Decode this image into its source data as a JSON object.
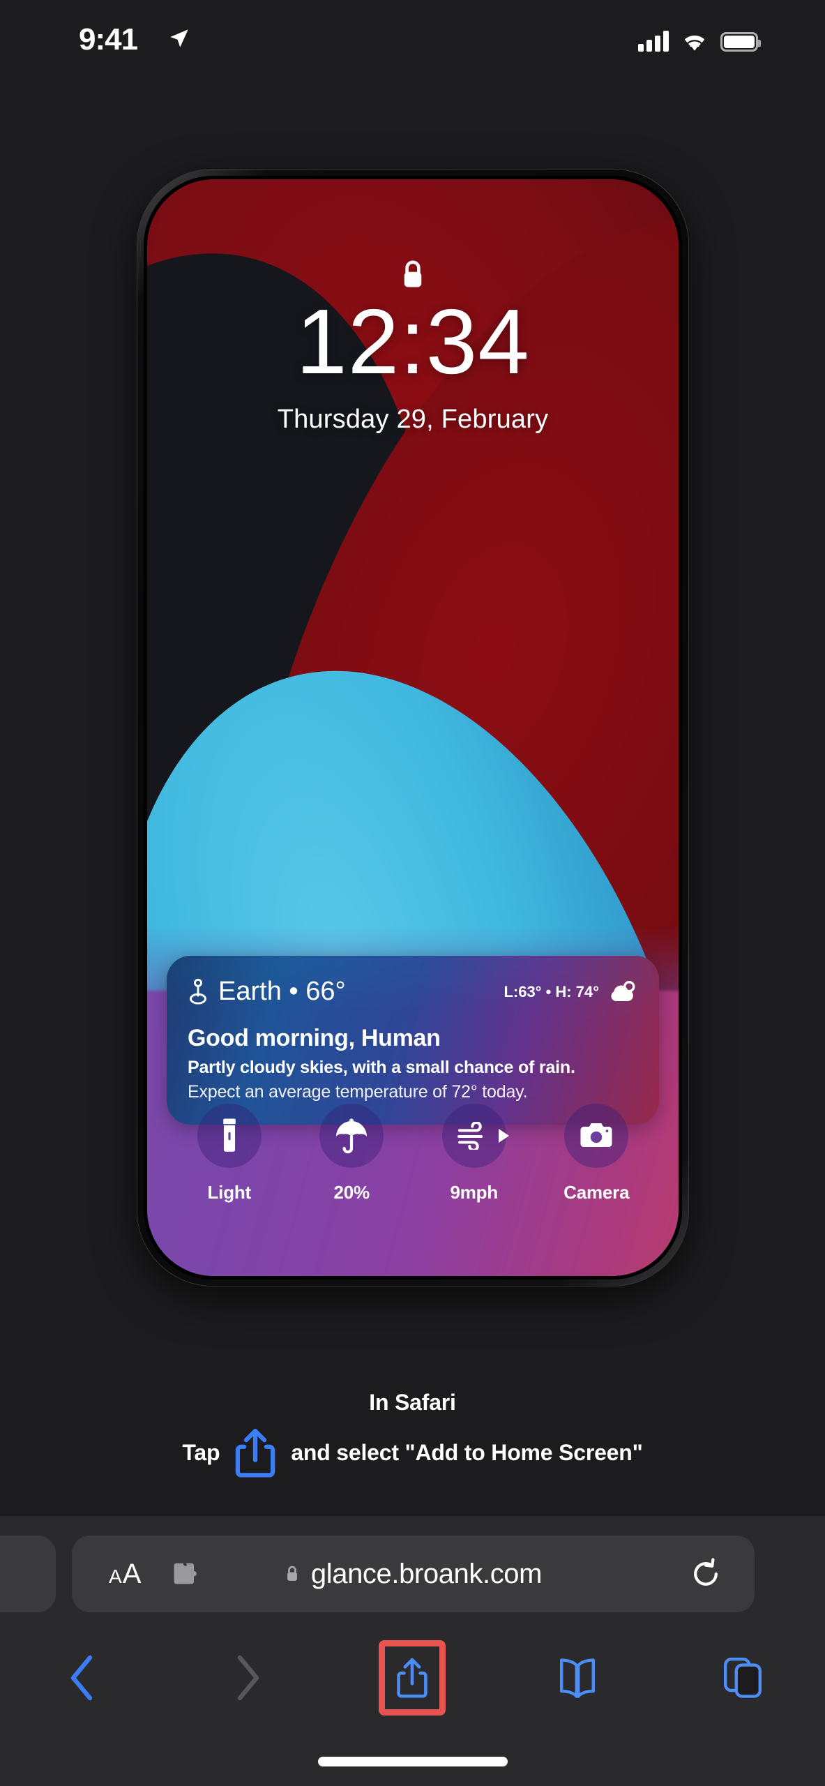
{
  "status_bar": {
    "time": "9:41",
    "location_icon": "location-arrow-icon",
    "signal_icon": "cellular-signal-icon",
    "wifi_icon": "wifi-icon",
    "battery_icon": "battery-full-icon"
  },
  "phone_preview": {
    "lock_icon": "lock-closed-icon",
    "time": "12:34",
    "date": "Thursday 29, February",
    "widget": {
      "location_icon": "location-pin-icon",
      "location": "Earth • 66°",
      "high_low": "L:63° • H: 74°",
      "condition_icon": "cloud-icon",
      "greeting": "Good morning, Human",
      "summary_line1": "Partly cloudy skies, with a small chance of rain.",
      "summary_line2": "Expect an average temperature of 72° today."
    },
    "actions": [
      {
        "icon": "flashlight-icon",
        "label": "Light"
      },
      {
        "icon": "umbrella-icon",
        "label": "20%"
      },
      {
        "icon": "wind-icon",
        "label": "9mph"
      },
      {
        "icon": "camera-icon",
        "label": "Camera"
      }
    ]
  },
  "instructions": {
    "title": "In Safari",
    "tap_word": "Tap",
    "share_icon": "share-ios-icon",
    "rest": "and select \"Add to Home Screen\""
  },
  "safari": {
    "text_size_small": "A",
    "text_size_large": "A",
    "extensions_icon": "puzzle-piece-icon",
    "secure_icon": "lock-closed-icon",
    "url": "glance.broank.com",
    "reload_icon": "reload-icon",
    "toolbar": [
      {
        "icon": "back-chevron-icon",
        "name": "back-button",
        "state": "enabled"
      },
      {
        "icon": "forward-chevron-icon",
        "name": "forward-button",
        "state": "disabled"
      },
      {
        "icon": "share-ios-icon",
        "name": "share-button",
        "state": "highlighted"
      },
      {
        "icon": "bookmarks-book-icon",
        "name": "bookmarks-button",
        "state": "enabled"
      },
      {
        "icon": "tabs-overview-icon",
        "name": "tabs-button",
        "state": "enabled"
      }
    ]
  },
  "colors": {
    "page_background": "#1c1c1e",
    "safari_chrome": "#2a2a2c",
    "url_field": "#3a3a3c",
    "accent_blue": "#3b7df5",
    "highlight_red": "#e8544f",
    "disabled_gray": "#58585c",
    "text_white": "#ffffff"
  }
}
